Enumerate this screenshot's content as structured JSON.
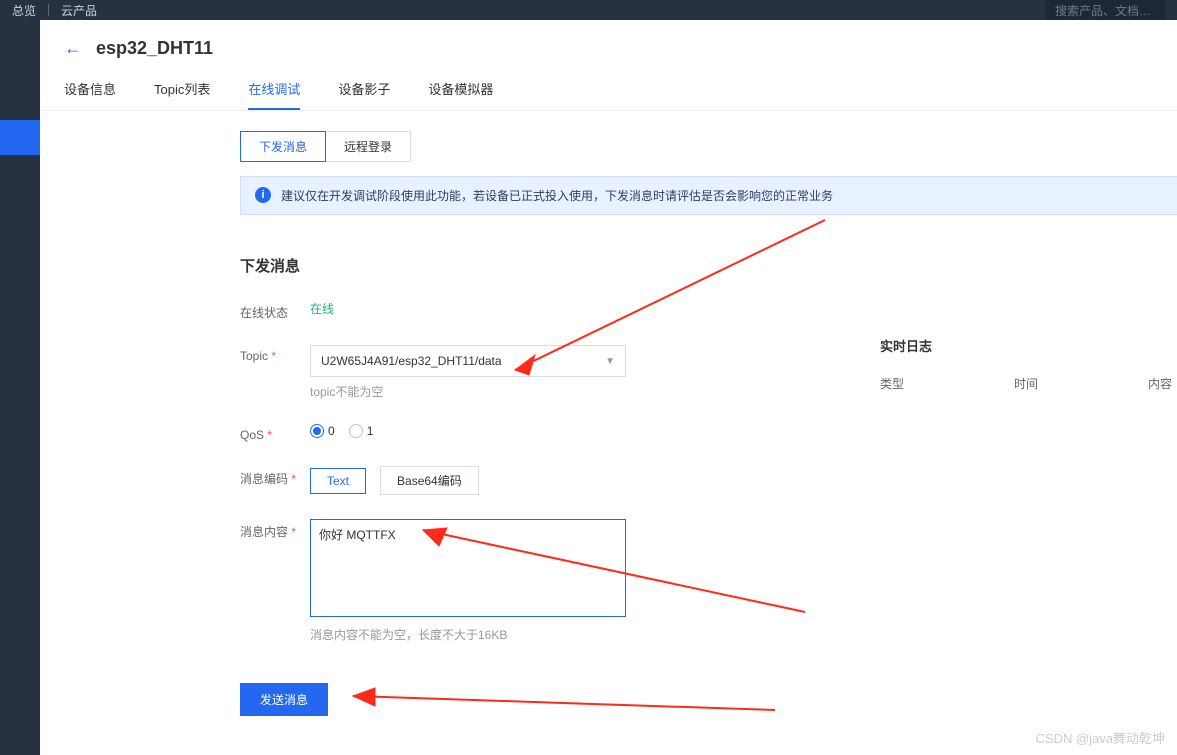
{
  "topbar": {
    "overview": "总览",
    "products": "云产品",
    "search_placeholder": "搜索产品、文档…"
  },
  "header": {
    "title": "esp32_DHT11"
  },
  "tabs": {
    "t0": "设备信息",
    "t1": "Topic列表",
    "t2": "在线调试",
    "t3": "设备影子",
    "t4": "设备模拟器"
  },
  "subtabs": {
    "s0": "下发消息",
    "s1": "远程登录"
  },
  "alert": {
    "text": "建议仅在开发调试阶段使用此功能，若设备已正式投入使用，下发消息时请评估是否会影响您的正常业务"
  },
  "section": {
    "title": "下发消息"
  },
  "form": {
    "status_label": "在线状态",
    "status_value": "在线",
    "topic_label": "Topic",
    "topic_value": "U2W65J4A91/esp32_DHT11/data",
    "topic_hint": "topic不能为空",
    "qos_label": "QoS",
    "qos_opt0": "0",
    "qos_opt1": "1",
    "enc_label": "消息编码",
    "enc_text": "Text",
    "enc_b64": "Base64编码",
    "msg_label": "消息内容",
    "msg_value": "你好 MQTTFX",
    "msg_hint": "消息内容不能为空，长度不大于16KB"
  },
  "submit": {
    "label": "发送消息"
  },
  "log": {
    "title": "实时日志",
    "col0": "类型",
    "col1": "时间",
    "col2": "内容"
  },
  "watermark": "CSDN @java舞动乾坤"
}
